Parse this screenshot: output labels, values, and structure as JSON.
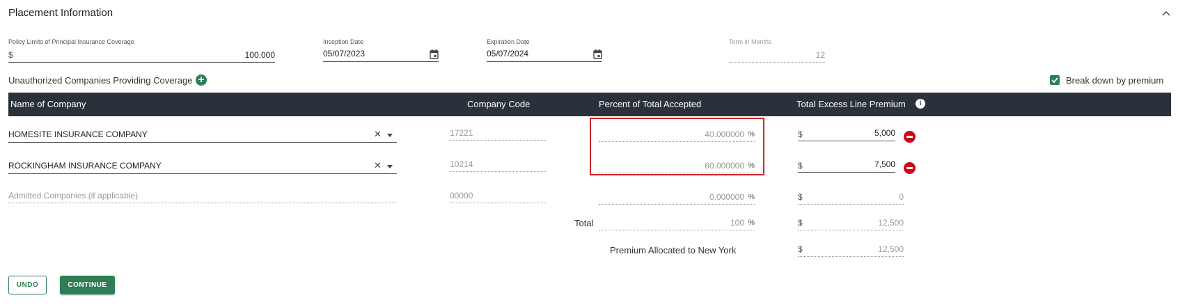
{
  "section": {
    "title": "Placement Information"
  },
  "policy_limits": {
    "label": "Policy Limits of Principal Insurance Coverage",
    "currency": "$",
    "value": "100,000"
  },
  "inception": {
    "label": "Inception Date",
    "value": "05/07/2023"
  },
  "expiration": {
    "label": "Expiration Date",
    "value": "05/07/2024"
  },
  "term": {
    "label": "Term in Months",
    "value": "12"
  },
  "unauthorized": {
    "label": "Unauthorized Companies Providing Coverage"
  },
  "breakdown": {
    "label": "Break down by premium",
    "checked": true
  },
  "table": {
    "headers": {
      "name": "Name of Company",
      "code": "Company Code",
      "percent": "Percent of Total Accepted",
      "premium": "Total Excess Line Premium"
    },
    "rows": [
      {
        "name": "HOMESITE INSURANCE COMPANY",
        "code": "17221",
        "percent": "40.000000",
        "pct_sign": "%",
        "currency": "$",
        "premium": "5,000"
      },
      {
        "name": "ROCKINGHAM INSURANCE COMPANY",
        "code": "10214",
        "percent": "60.000000",
        "pct_sign": "%",
        "currency": "$",
        "premium": "7,500"
      }
    ],
    "admitted": {
      "placeholder": "Admitted Companies (if applicable)",
      "code": "00000",
      "percent": "0.000000",
      "pct_sign": "%",
      "currency": "$",
      "premium": "0"
    },
    "total": {
      "label": "Total",
      "percent": "100",
      "pct_sign": "%",
      "currency": "$",
      "premium": "12,500"
    },
    "ny": {
      "label": "Premium Allocated to New York",
      "currency": "$",
      "premium": "12,500"
    }
  },
  "buttons": {
    "undo": "UNDO",
    "continue": "CONTINUE"
  },
  "colors": {
    "accent": "#2e7d55",
    "header_bg": "#2b313a",
    "remove": "#d0021b",
    "highlight": "#d0262d"
  }
}
